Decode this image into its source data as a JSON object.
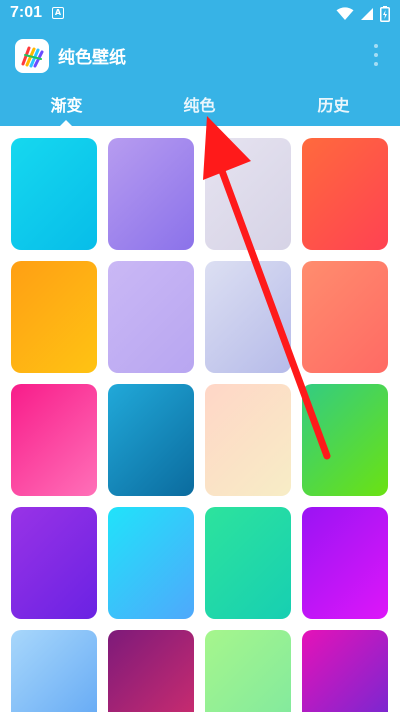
{
  "status_bar": {
    "time": "7:01",
    "notification_letter": "A"
  },
  "app_bar": {
    "title": "纯色壁纸"
  },
  "tabs": [
    {
      "label": "渐变",
      "active": true
    },
    {
      "label": "纯色",
      "active": false
    },
    {
      "label": "历史",
      "active": false
    }
  ],
  "colors": {
    "header": "#37b3e6",
    "annotation_arrow": "#ff1a1a"
  },
  "wallpapers": [
    {
      "from": "#16d8ef",
      "to": "#07bde9"
    },
    {
      "from": "#b79cf0",
      "to": "#8b72ea"
    },
    {
      "from": "#e6e3f0",
      "to": "#d6d3e6"
    },
    {
      "from": "#ff6a3d",
      "to": "#ff4252"
    },
    {
      "from": "#ff9f14",
      "to": "#ffc313"
    },
    {
      "from": "#cab8f5",
      "to": "#b8a6f1"
    },
    {
      "from": "#dcdff2",
      "to": "#b6bbe9"
    },
    {
      "from": "#ff8d6e",
      "to": "#ff6a64"
    },
    {
      "from": "#f81c8a",
      "to": "#ff70b8"
    },
    {
      "from": "#21a9d9",
      "to": "#0b6b9e"
    },
    {
      "from": "#ffd6c7",
      "to": "#f7edc6"
    },
    {
      "from": "#33cc82",
      "to": "#6be212"
    },
    {
      "from": "#9933e6",
      "to": "#6a22e3"
    },
    {
      "from": "#20e3fa",
      "to": "#4fa8fb"
    },
    {
      "from": "#2de39d",
      "to": "#17cfb2"
    },
    {
      "from": "#9a14f4",
      "to": "#dd16f9"
    },
    {
      "from": "#a8d7fb",
      "to": "#5ea5f4"
    },
    {
      "from": "#7d1a7a",
      "to": "#d32e6e"
    },
    {
      "from": "#a6f68c",
      "to": "#7ee8a0"
    },
    {
      "from": "#e512b8",
      "to": "#6a2ad4"
    }
  ]
}
